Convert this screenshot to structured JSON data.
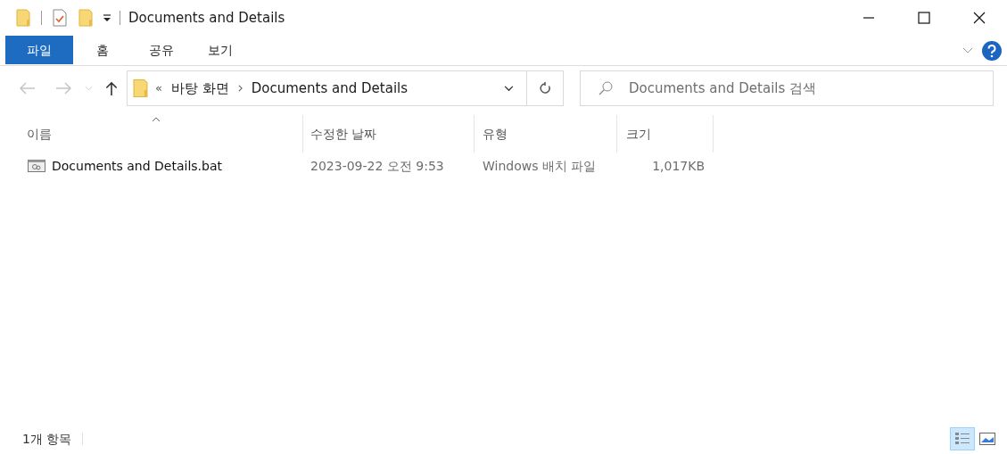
{
  "window": {
    "title": "Documents and Details"
  },
  "ribbon_tabs": [
    {
      "label": "파일",
      "selected": true
    },
    {
      "label": "홈",
      "selected": false
    },
    {
      "label": "공유",
      "selected": false
    },
    {
      "label": "보기",
      "selected": false
    }
  ],
  "address_bar": {
    "overflow": "«",
    "breadcrumbs": [
      "바탕 화면",
      "Documents and Details"
    ]
  },
  "search": {
    "placeholder": "Documents and Details 검색"
  },
  "table": {
    "columns": [
      {
        "label": "이름",
        "sorted": true
      },
      {
        "label": "수정한 날짜",
        "sorted": false
      },
      {
        "label": "유형",
        "sorted": false
      },
      {
        "label": "크기",
        "sorted": false
      }
    ],
    "rows": [
      {
        "name": "Documents and Details.bat",
        "modified": "2023-09-22 오전 9:53",
        "type": "Windows 배치 파일",
        "size": "1,017KB"
      }
    ]
  },
  "status_bar": {
    "item_count": "1개 항목",
    "views": [
      {
        "kind": "details",
        "selected": true
      },
      {
        "kind": "large-icons",
        "selected": false
      }
    ]
  }
}
